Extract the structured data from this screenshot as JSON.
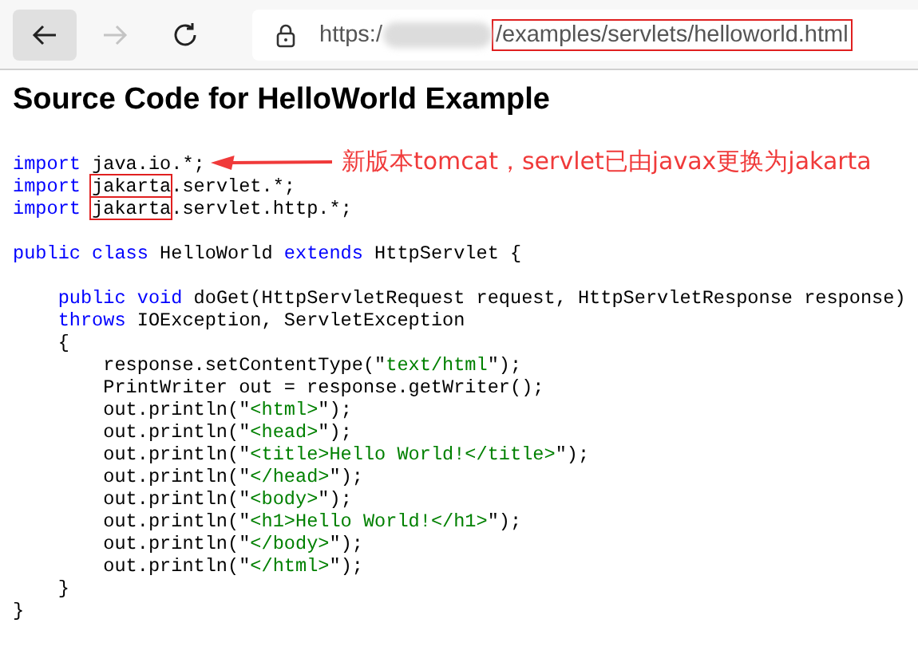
{
  "toolbar": {
    "nav_buttons": [
      {
        "kind": "back",
        "disabled": false
      },
      {
        "kind": "forward",
        "disabled": true
      },
      {
        "kind": "reload",
        "disabled": false
      }
    ],
    "address": {
      "scheme": "https:/",
      "path": "/examples/servlets/helloworld.html",
      "path_highlighted": true
    }
  },
  "page": {
    "heading": "Source Code for HelloWorld Example",
    "annotation": "新版本tomcat，servlet已由javax更换为jakarta",
    "code_lines": [
      {
        "kind": "code",
        "segments": [
          {
            "kind": "kw",
            "text": "import"
          },
          {
            "kind": "plain",
            "text": " java.io.*;"
          }
        ]
      },
      {
        "kind": "code",
        "segments": [
          {
            "kind": "kw",
            "text": "import "
          },
          {
            "kind": "plain",
            "text": "jakarta",
            "boxed": true
          },
          {
            "kind": "plain",
            "text": ".servlet.*;"
          }
        ]
      },
      {
        "kind": "code",
        "segments": [
          {
            "kind": "kw",
            "text": "import "
          },
          {
            "kind": "plain",
            "text": "jakarta",
            "boxed": true
          },
          {
            "kind": "plain",
            "text": ".servlet.http.*;"
          }
        ]
      },
      {
        "kind": "blank"
      },
      {
        "kind": "code",
        "segments": [
          {
            "kind": "kw",
            "text": "public class"
          },
          {
            "kind": "plain",
            "text": " HelloWorld "
          },
          {
            "kind": "kw",
            "text": "extends"
          },
          {
            "kind": "plain",
            "text": " HttpServlet {"
          }
        ]
      },
      {
        "kind": "blank"
      },
      {
        "kind": "code",
        "segments": [
          {
            "kind": "kw",
            "text": "    public void"
          },
          {
            "kind": "plain",
            "text": " doGet(HttpServletRequest request, HttpServletResponse response)"
          }
        ]
      },
      {
        "kind": "code",
        "segments": [
          {
            "kind": "kw",
            "text": "    throws"
          },
          {
            "kind": "plain",
            "text": " IOException, ServletException"
          }
        ]
      },
      {
        "kind": "code",
        "segments": [
          {
            "kind": "plain",
            "text": "    {"
          }
        ]
      },
      {
        "kind": "code",
        "segments": [
          {
            "kind": "plain",
            "text": "        response.setContentType(\""
          },
          {
            "kind": "str",
            "text": "text/html"
          },
          {
            "kind": "plain",
            "text": "\");"
          }
        ]
      },
      {
        "kind": "code",
        "segments": [
          {
            "kind": "plain",
            "text": "        PrintWriter out = response.getWriter();"
          }
        ]
      },
      {
        "kind": "code",
        "segments": [
          {
            "kind": "plain",
            "text": "        out.println(\""
          },
          {
            "kind": "str",
            "text": "<html>"
          },
          {
            "kind": "plain",
            "text": "\");"
          }
        ]
      },
      {
        "kind": "code",
        "segments": [
          {
            "kind": "plain",
            "text": "        out.println(\""
          },
          {
            "kind": "str",
            "text": "<head>"
          },
          {
            "kind": "plain",
            "text": "\");"
          }
        ]
      },
      {
        "kind": "code",
        "segments": [
          {
            "kind": "plain",
            "text": "        out.println(\""
          },
          {
            "kind": "str",
            "text": "<title>Hello World!</title>"
          },
          {
            "kind": "plain",
            "text": "\");"
          }
        ]
      },
      {
        "kind": "code",
        "segments": [
          {
            "kind": "plain",
            "text": "        out.println(\""
          },
          {
            "kind": "str",
            "text": "</head>"
          },
          {
            "kind": "plain",
            "text": "\");"
          }
        ]
      },
      {
        "kind": "code",
        "segments": [
          {
            "kind": "plain",
            "text": "        out.println(\""
          },
          {
            "kind": "str",
            "text": "<body>"
          },
          {
            "kind": "plain",
            "text": "\");"
          }
        ]
      },
      {
        "kind": "code",
        "segments": [
          {
            "kind": "plain",
            "text": "        out.println(\""
          },
          {
            "kind": "str",
            "text": "<h1>Hello World!</h1>"
          },
          {
            "kind": "plain",
            "text": "\");"
          }
        ]
      },
      {
        "kind": "code",
        "segments": [
          {
            "kind": "plain",
            "text": "        out.println(\""
          },
          {
            "kind": "str",
            "text": "</body>"
          },
          {
            "kind": "plain",
            "text": "\");"
          }
        ]
      },
      {
        "kind": "code",
        "segments": [
          {
            "kind": "plain",
            "text": "        out.println(\""
          },
          {
            "kind": "str",
            "text": "</html>"
          },
          {
            "kind": "plain",
            "text": "\");"
          }
        ]
      },
      {
        "kind": "code",
        "segments": [
          {
            "kind": "plain",
            "text": "    }"
          }
        ]
      },
      {
        "kind": "code",
        "segments": [
          {
            "kind": "plain",
            "text": "}"
          }
        ]
      }
    ]
  }
}
